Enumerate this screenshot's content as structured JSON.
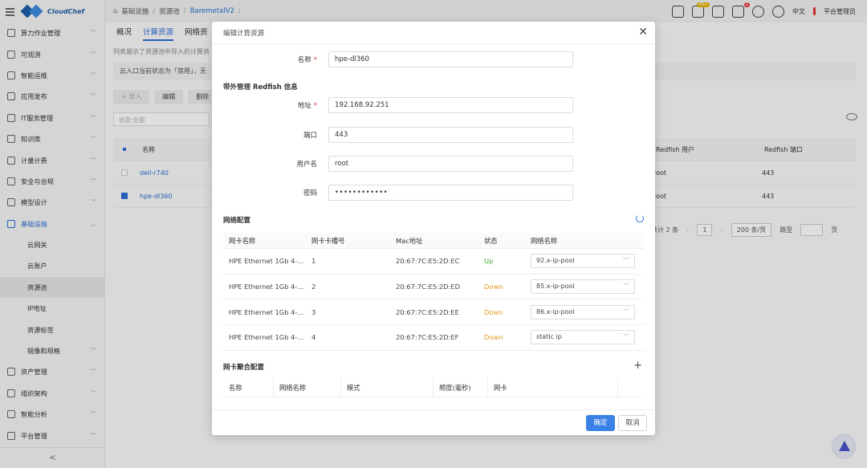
{
  "brand": {
    "name": "CloudChef"
  },
  "sidebar": {
    "items": [
      {
        "label": "算力作业管理"
      },
      {
        "label": "可观测"
      },
      {
        "label": "智能运维"
      },
      {
        "label": "应用发布"
      },
      {
        "label": "IT服务管理"
      },
      {
        "label": "知识库"
      },
      {
        "label": "计量计费"
      },
      {
        "label": "安全与合规"
      },
      {
        "label": "模型设计"
      },
      {
        "label": "基础设施"
      }
    ],
    "sub": [
      {
        "label": "云网关"
      },
      {
        "label": "云账户"
      },
      {
        "label": "资源池"
      },
      {
        "label": "IP地址"
      },
      {
        "label": "资源标签"
      },
      {
        "label": "镜像和规格"
      }
    ],
    "bottom": [
      {
        "label": "资产管理"
      },
      {
        "label": "组织架构"
      },
      {
        "label": "智能分析"
      },
      {
        "label": "平台管理"
      }
    ],
    "collapse": "<"
  },
  "header": {
    "breadcrumbs": [
      "基础设施",
      "资源池",
      "BaremetalV2"
    ],
    "badge_notify": "99+",
    "badge_task": "2",
    "lang": "中文",
    "user": "平台管理员"
  },
  "page": {
    "tabs": [
      "概况",
      "计算资源",
      "网络资"
    ],
    "desc": "列表展示了资源池中导入的计算资",
    "notice": "云入口当前状态为「禁用」，无",
    "buttons": [
      "+ 导入",
      "编辑",
      "删除"
    ],
    "filter_placeholder": "状态:全部",
    "table": {
      "headers": [
        "名称",
        "Redfish 用户",
        "Redfish 端口"
      ],
      "rows": [
        {
          "name": "dell-r740",
          "user": "root",
          "port": "443"
        },
        {
          "name": "hpe-dl360",
          "user": "root",
          "port": "443"
        }
      ]
    },
    "pager": {
      "total": "共计 2 条",
      "page": "1",
      "size": "200 条/页",
      "jump": "跳至",
      "unit": "页"
    }
  },
  "modal": {
    "title": "编辑计算资源",
    "name_label": "名称",
    "name_value": "hpe-dl360",
    "redfish_section": "带外管理 Redfish 信息",
    "addr_label": "地址",
    "addr_value": "192.168.92.251",
    "port_label": "端口",
    "port_value": "443",
    "user_label": "用户名",
    "user_value": "root",
    "pwd_label": "密码",
    "pwd_value": "••••••••••••",
    "net_section": "网络配置",
    "nic_headers": [
      "网卡名称",
      "网卡卡槽号",
      "Mac地址",
      "状态",
      "网络名称"
    ],
    "nics": [
      {
        "name": "HPE Ethernet 1Gb 4-...",
        "slot": "1",
        "mac": "20:67:7C:E5:2D:EC",
        "status": "Up",
        "network": "92.x-ip-pool"
      },
      {
        "name": "HPE Ethernet 1Gb 4-...",
        "slot": "2",
        "mac": "20:67:7C:E5:2D:ED",
        "status": "Down",
        "network": "85.x-ip-pool"
      },
      {
        "name": "HPE Ethernet 1Gb 4-...",
        "slot": "3",
        "mac": "20:67:7C:E5:2D:EE",
        "status": "Down",
        "network": "86.x-ip-pool"
      },
      {
        "name": "HPE Ethernet 1Gb 4-...",
        "slot": "4",
        "mac": "20:67:7C:E5:2D:EF",
        "status": "Down",
        "network": "static ip"
      }
    ],
    "agg_section": "网卡聚合配置",
    "agg_headers": [
      "名称",
      "网络名称",
      "模式",
      "频度(毫秒)",
      "网卡"
    ],
    "ok": "确定",
    "cancel": "取消"
  },
  "colors": {
    "accent": "#2d6fd6",
    "up": "#3aa830",
    "down": "#e09a19",
    "primary_button": "#3b82e6"
  }
}
